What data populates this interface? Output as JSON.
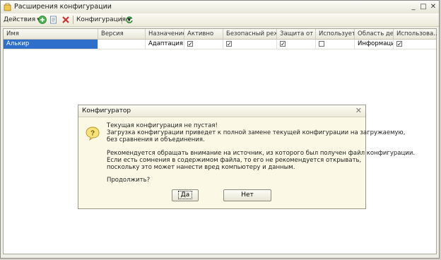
{
  "window": {
    "title": "Расширения конфигурации",
    "controls": [
      "_",
      "□",
      "✕"
    ]
  },
  "toolbar": {
    "actions_label": "Действия",
    "configuration_label": "Конфигурация"
  },
  "table": {
    "columns": [
      "Имя",
      "Версия",
      "Назначение",
      "Активно",
      "Безопасный реж...",
      "Защита от о...",
      "Использует...",
      "Область де...",
      "Использова..."
    ],
    "rows": [
      {
        "name": "Алькир",
        "version": "",
        "purpose": "Адаптация",
        "active": true,
        "safe_mode": true,
        "protection": true,
        "uses": false,
        "scope": "Информаци...",
        "used": true
      }
    ]
  },
  "dialog": {
    "title": "Конфигуратор",
    "lines": [
      "Текущая конфигурация не пустая!",
      "Загрузка конфигурации приведет к полной замене текущей конфигурации на загружаемую,",
      "без сравнения и объединения.",
      "Рекомендуется обращать внимание на источник, из которого был получен файл конфигурации.",
      "Если есть сомнения в содержимом файла, то его не рекомендуется открывать,",
      "поскольку это может нанести вред компьютеру и данным.",
      "Продолжить?"
    ],
    "yes_label": "Да",
    "no_label": "Нет"
  },
  "icons": {
    "window": "extension-icon",
    "add": "add-icon",
    "edit": "edit-icon",
    "delete": "delete-icon",
    "refresh": "refresh-icon",
    "question": "question-icon"
  },
  "colors": {
    "selection": "#2f6fcc",
    "dialog_bg": "#fbf9e6"
  }
}
